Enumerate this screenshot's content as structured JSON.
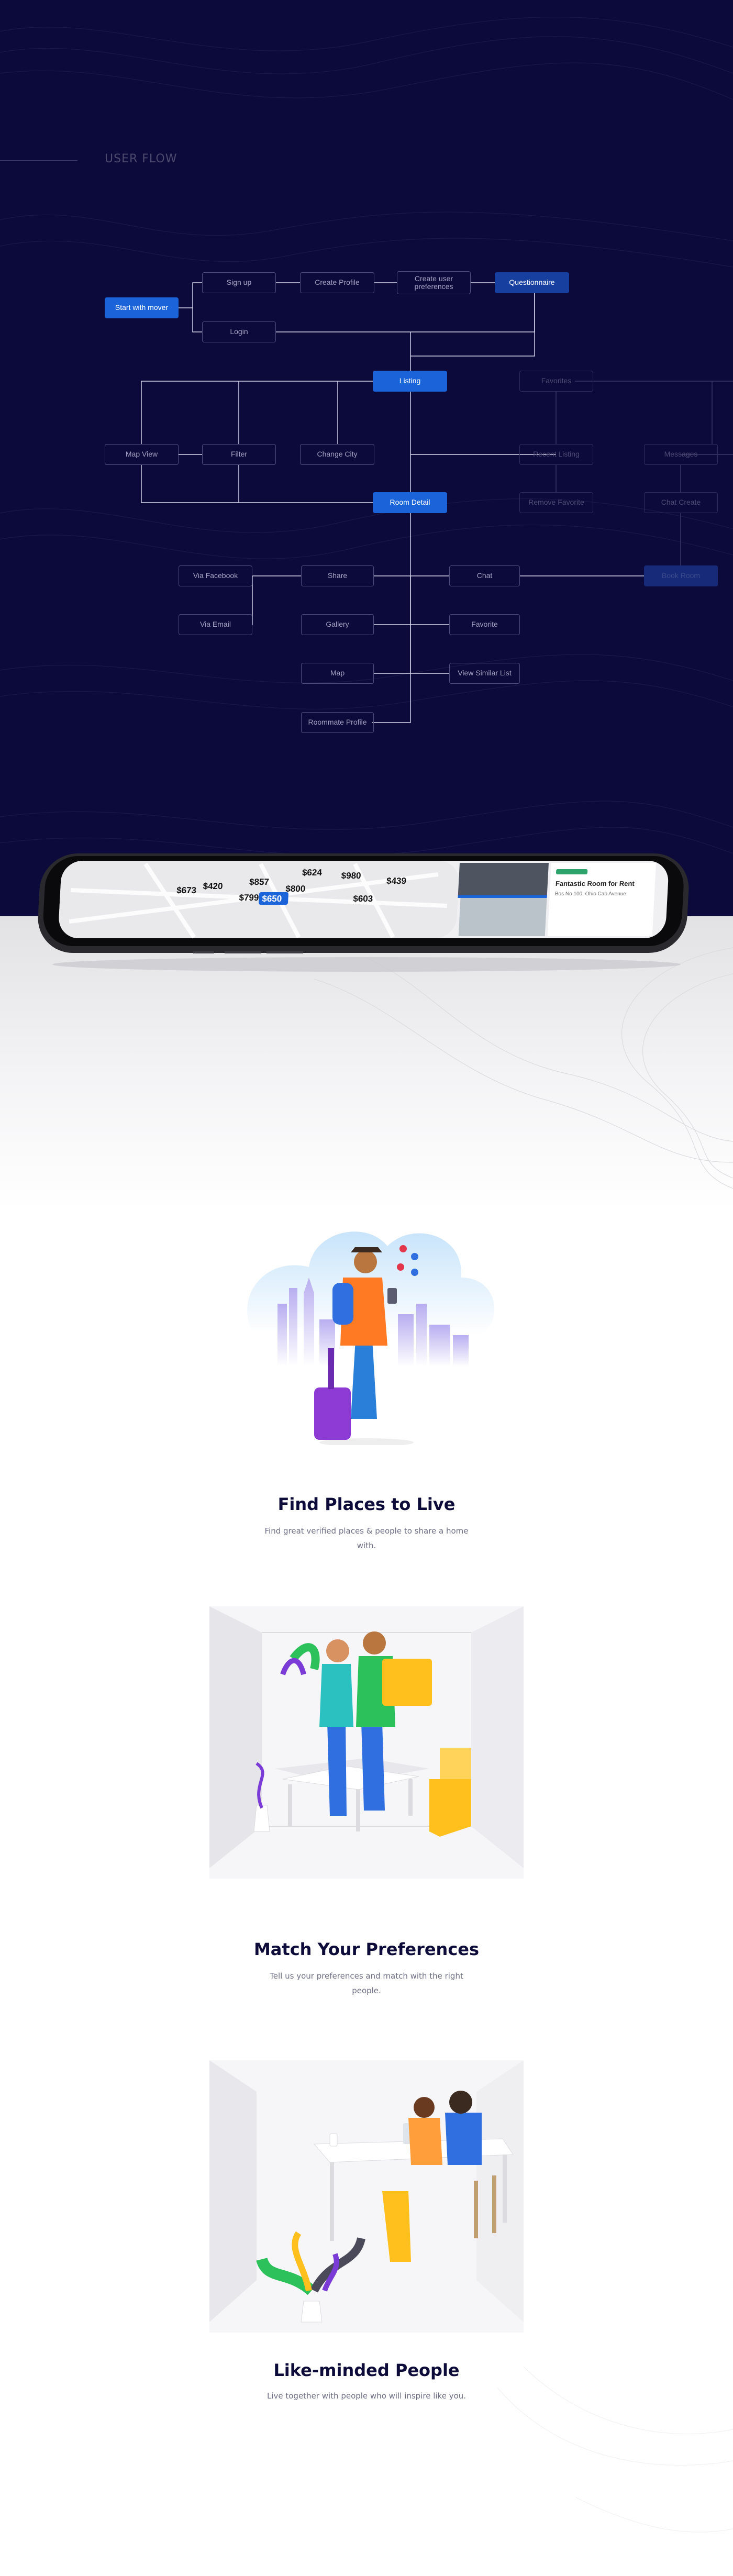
{
  "section": {
    "title": "USER FLOW"
  },
  "flow": {
    "start": "Start with mover",
    "signup": "Sign up",
    "login": "Login",
    "create_profile": "Create Profile",
    "create_prefs": "Create user preferences",
    "questionnaire": "Questionnaire",
    "listing": "Listing",
    "favorites": "Favorites",
    "map_view": "Map View",
    "filter": "Filter",
    "change_city": "Change City",
    "recent_listing": "Recent Listing",
    "messages": "Messages",
    "room_detail": "Room Detail",
    "remove_favorite": "Remove Favorite",
    "chat_create": "Chat Create",
    "via_facebook": "Via Facebook",
    "via_email": "Via Email",
    "share": "Share",
    "chat": "Chat",
    "book_room": "Book Room",
    "gallery": "Gallery",
    "favorite": "Favorite",
    "map": "Map",
    "view_similar": "View Similar List",
    "roommate_profile": "Roommate Profile"
  },
  "phone": {
    "prices": [
      "$624",
      "$980",
      "$857",
      "$420",
      "$439",
      "$673",
      "$800",
      "$799",
      "$650",
      "$603"
    ],
    "selected_price": "$650",
    "listing_title": "Fantastic Room for Rent",
    "listing_address": "Bos No 100, Ohio Cab Avenue"
  },
  "features": [
    {
      "title": "Find Places to Live",
      "desc": "Find great verified places & people to share a home with."
    },
    {
      "title": "Match Your Preferences",
      "desc": "Tell us your preferences and match with the right people."
    },
    {
      "title": "Like-minded People",
      "desc": "Live together with people who will inspire like you."
    }
  ],
  "colors": {
    "navy": "#0c0a3a",
    "accent": "#1b63d9",
    "orange": "#ff7a22",
    "yellow": "#ffc01e",
    "purple": "#8e3bd6"
  }
}
